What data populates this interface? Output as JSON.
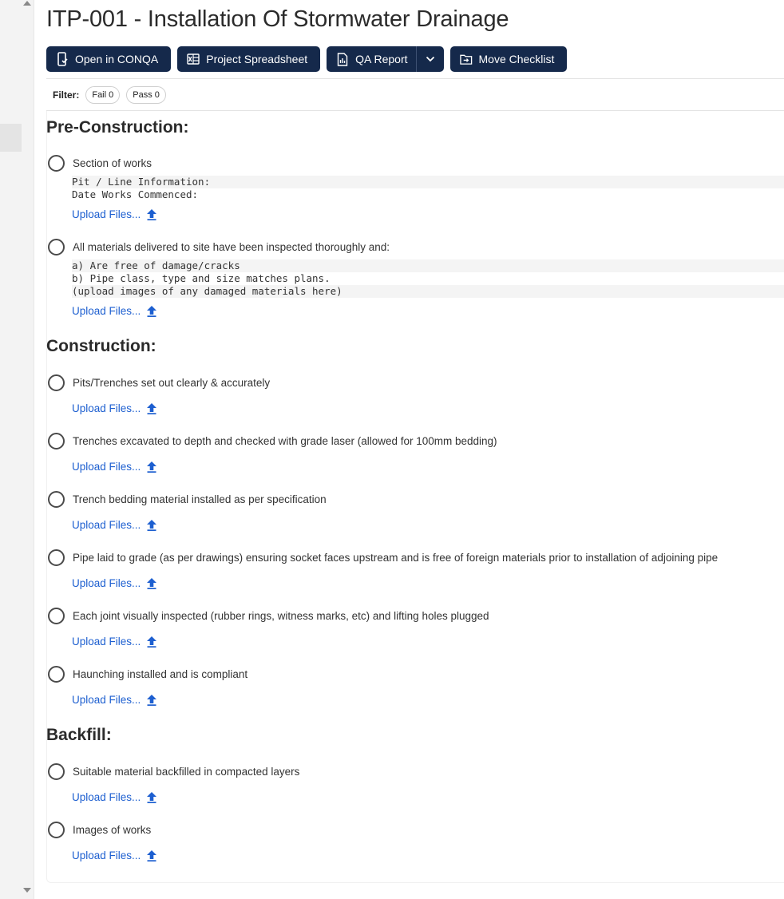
{
  "title": "ITP-001 - Installation Of Stormwater Drainage",
  "toolbar": {
    "open_conqa": "Open in CONQA",
    "project_spreadsheet": "Project Spreadsheet",
    "qa_report": "QA Report",
    "move_checklist": "Move Checklist"
  },
  "filter": {
    "label": "Filter:",
    "fail": "Fail 0",
    "pass": "Pass 0"
  },
  "upload_label": "Upload Files...",
  "sections": {
    "pre": {
      "heading": "Pre-Construction:",
      "items": [
        {
          "label": "Section of works",
          "notes": [
            "Pit / Line Information:",
            "Date Works Commenced:"
          ]
        },
        {
          "label": "All materials delivered to site have been inspected thoroughly and:",
          "notes": [
            "a) Are free of damage/cracks",
            "b) Pipe class, type and size matches plans.",
            "(upload images of any damaged materials here)"
          ]
        }
      ]
    },
    "construction": {
      "heading": "Construction:",
      "items": [
        {
          "label": "Pits/Trenches set out clearly & accurately"
        },
        {
          "label": "Trenches excavated to depth and checked with grade laser (allowed for 100mm bedding)"
        },
        {
          "label": "Trench bedding material installed as per specification"
        },
        {
          "label": "Pipe laid to grade (as per drawings) ensuring socket faces upstream and is free of foreign materials prior to installation of adjoining pipe"
        },
        {
          "label": "Each joint visually inspected (rubber rings, witness marks, etc) and lifting holes plugged"
        },
        {
          "label": "Haunching installed and is compliant"
        }
      ]
    },
    "backfill": {
      "heading": "Backfill:",
      "items": [
        {
          "label": "Suitable material backfilled in compacted layers"
        },
        {
          "label": "Images of works"
        }
      ]
    }
  },
  "colors": {
    "button_bg": "#15294b",
    "link": "#1d5fd0"
  }
}
